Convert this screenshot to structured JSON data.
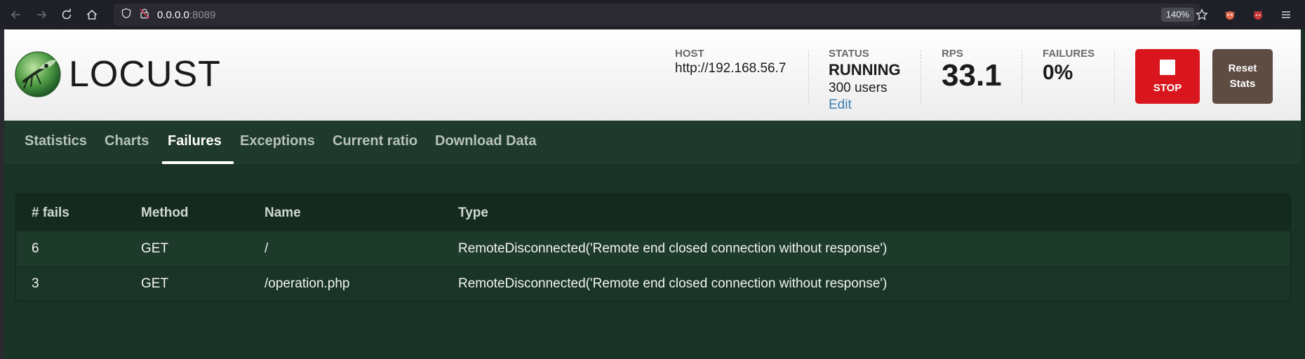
{
  "browser": {
    "url_host": "0.0.0.0",
    "url_port": ":8089",
    "zoom": "140%"
  },
  "app": {
    "logo_text": "LOCUST"
  },
  "header": {
    "host": {
      "label": "HOST",
      "value": "http://192.168.56.7"
    },
    "status": {
      "label": "STATUS",
      "value": "RUNNING",
      "users": "300 users",
      "edit": "Edit"
    },
    "rps": {
      "label": "RPS",
      "value": "33.1"
    },
    "failures": {
      "label": "FAILURES",
      "value": "0%"
    },
    "stop_label": "STOP",
    "reset_label": "Reset Stats"
  },
  "tabs": [
    {
      "label": "Statistics"
    },
    {
      "label": "Charts"
    },
    {
      "label": "Failures",
      "active": true
    },
    {
      "label": "Exceptions"
    },
    {
      "label": "Current ratio"
    },
    {
      "label": "Download Data"
    }
  ],
  "table": {
    "headers": [
      "# fails",
      "Method",
      "Name",
      "Type"
    ],
    "rows": [
      [
        "6",
        "GET",
        "/",
        "RemoteDisconnected('Remote end closed connection without response')"
      ],
      [
        "3",
        "GET",
        "/operation.php",
        "RemoteDisconnected('Remote end closed connection without response')"
      ]
    ]
  },
  "colors": {
    "stop_button": "#d9161d",
    "reset_button": "#5e4c43",
    "page_bg": "#1a3327",
    "edit_link": "#3a7fb0"
  }
}
